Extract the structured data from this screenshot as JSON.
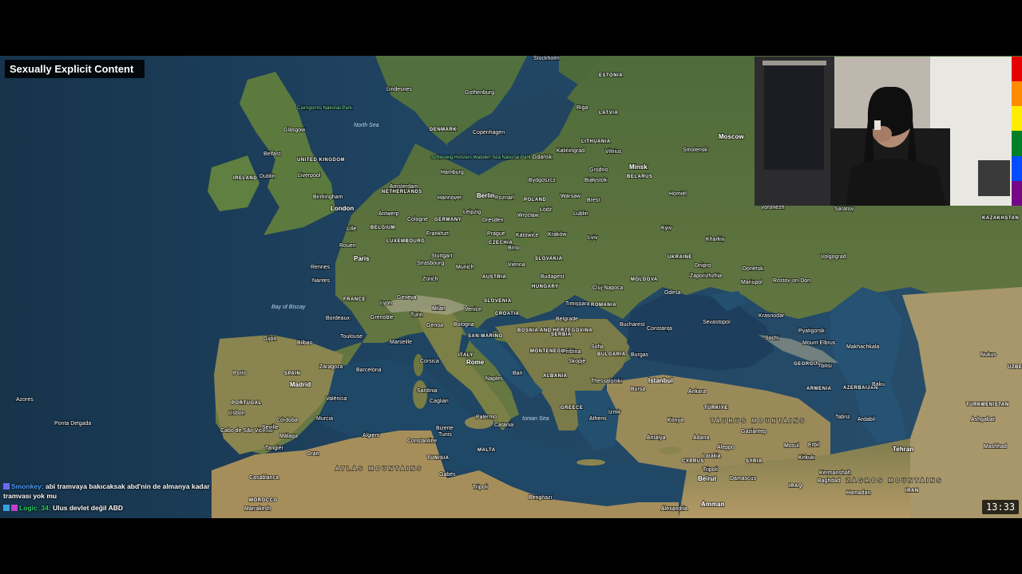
{
  "overlay": {
    "content_warning": "Sexually Explicit Content",
    "clock": "13:33",
    "rainbow_colors": [
      "#e40303",
      "#ff8c00",
      "#ffed00",
      "#008026",
      "#004dff",
      "#750787"
    ]
  },
  "chat": {
    "messages": [
      {
        "user": "Smonkey:",
        "user_color": "#4fa0ff",
        "text": "abi tramvaya bakıcaksak abd'nin de almanya kadar tramvası yok mu"
      },
      {
        "user": "Logic_34:",
        "user_color": "#2fd06a",
        "text": "Ulus devlet değil ABD"
      }
    ]
  },
  "map": {
    "labels": {
      "stockholm": "Stockholm",
      "estonia": "ESTONIA",
      "riga": "Riga",
      "latvia": "LATVIA",
      "lithuania": "LITHUANIA",
      "vilnius": "Vilnius",
      "minsk": "Minsk",
      "belarus": "BELARUS",
      "moscow": "Moscow",
      "smolensk": "Smolensk",
      "homiel": "Homiel",
      "brest": "Brest",
      "gothenburg": "Gothenburg",
      "denmark": "DENMARK",
      "copenhagen": "Copenhagen",
      "north_sea": "North Sea",
      "glasgow": "Glasgow",
      "cairngorms": "Cairngorms National Park",
      "belfast": "Belfast",
      "uk": "UNITED KINGDOM",
      "ireland": "IRELAND",
      "dublin": "Dublin",
      "liverpool": "Liverpool",
      "birmingham": "Birmingham",
      "london": "London",
      "wadden": "Schleswig-Holstein Wadden Sea National Park",
      "hamburg": "Hamburg",
      "gdansk": "Gdańsk",
      "kaliningrad": "Kaliningrad",
      "grodno": "Grodno",
      "bialystok": "Białystok",
      "bydgoszcz": "Bydgoszcz",
      "berlin": "Berlin",
      "poznan": "Poznań",
      "poland": "POLAND",
      "warsaw": "Warsaw",
      "lodz": "Łódź",
      "lublin": "Lublin",
      "wroclaw": "Wrocław",
      "netherlands": "NETHERLANDS",
      "amsterdam": "Amsterdam",
      "hanover": "Hannover",
      "antwerp": "Antwerp",
      "cologne": "Cologne",
      "germany": "GERMANY",
      "leipzig": "Leipzig",
      "dresden": "Dresden",
      "lille": "Lille",
      "belgium": "BELGIUM",
      "luxembourg": "LUXEMBOURG",
      "frankfurt": "Frankfurt",
      "prague": "Prague",
      "czechia": "CZECHIA",
      "katowice": "Katowice",
      "krakow": "Kraków",
      "lviv": "Lviv",
      "kyiv": "Kyiv",
      "kharkiv": "Kharkiv",
      "voronezh": "Voronezh",
      "saratov": "Saratov",
      "volgograd": "Volgograd",
      "rouen": "Rouen",
      "paris": "Paris",
      "stuttgart": "Stuttgart",
      "strasbourg": "Strasbourg",
      "munich": "Munich",
      "slovakia": "SLOVAKIA",
      "vienna": "Vienna",
      "brno": "Brno",
      "austria": "AUSTRIA",
      "budapest": "Budapest",
      "hungary": "HUNGARY",
      "ukraine": "UKRAINE",
      "dnipro": "Dnipro",
      "zaporizhzhia": "Zaporizhzhia",
      "donetsk": "Donetsk",
      "mariupol": "Mariupol",
      "rostov": "Rostov-on-Don",
      "moldova": "MOLDOVA",
      "cluj": "Cluj-Napoca",
      "romania": "ROMANIA",
      "timisoara": "Timișoara",
      "odesa": "Odesa",
      "rennes": "Rennes",
      "nantes": "Nantes",
      "france": "FRANCE",
      "zurich": "Zürich",
      "geneva": "Geneva",
      "lyon": "Lyon",
      "milan": "Milan",
      "venice": "Venice",
      "slovenia": "SLOVENIA",
      "croatia": "CROATIA",
      "belgrade": "Belgrade",
      "bucharest": "Bucharest",
      "constanta": "Constanța",
      "sevastopol": "Sevastopol",
      "krasnodar": "Krasnodar",
      "bay_of_biscay": "Bay of Biscay",
      "bordeaux": "Bordeaux",
      "grenoble": "Grenoble",
      "turin": "Turin",
      "genoa": "Genoa",
      "bologna": "Bologna",
      "bosnia": "BOSNIA AND HERZEGOVINA",
      "serbia": "SERBIA",
      "bulgaria": "BULGARIA",
      "sochi": "Sochi",
      "pyatigorsk": "Pyatigorsk",
      "makhachkala": "Makhachkala",
      "gijon": "Gijón",
      "bilbao": "Bilbao",
      "toulouse": "Toulouse",
      "marseille": "Marseille",
      "san_marino": "SAN MARINO",
      "montenegro": "MONTENEGRO",
      "pristina": "Priština",
      "sofia": "Sofia",
      "burgas": "Burgas",
      "georgia": "GEORGIA",
      "tbilisi": "Tbilisi",
      "porto": "Porto",
      "spain": "SPAIN",
      "zaragoza": "Zaragoza",
      "barcelona": "Barcelona",
      "rome": "Rome",
      "italy": "ITALY",
      "skopje": "Skopje",
      "albania": "ALBANIA",
      "thessaloniki": "Thessaloniki",
      "istanbul": "Istanbul",
      "madrid": "Madrid",
      "portugal": "PORTUGAL",
      "valencia": "València",
      "corsica": "Corsica",
      "sardinia": "Sardinia",
      "naples": "Naples",
      "bari": "Bari",
      "ankara": "Ankara",
      "armenia": "ARMENIA",
      "azerbaijan": "AZERBAIJAN",
      "baku": "Baku",
      "bursa": "Bursa",
      "azores": "Azores",
      "ponta_delgada": "Ponta Delgada",
      "lisbon": "Lisbon",
      "cordoba": "Córdoba",
      "murcia": "Murcia",
      "cagliari": "Cagliari",
      "ionian_sea": "Ionian Sea",
      "greece": "GREECE",
      "athens": "Athens",
      "izmir": "İzmir",
      "turkiye": "TÜRKİYE",
      "turkmenistan": "TURKMENISTAN",
      "ashgabat": "Ashgabat",
      "cabo": "Cabo de São Vicente",
      "seville": "Seville",
      "malaga": "Málaga",
      "algiers": "Algiers",
      "constantine": "Constantine",
      "bizerte": "Bizerte",
      "tunis": "Tunis",
      "palermo": "Palermo",
      "catania": "Catania",
      "konya": "Konya",
      "taurus": "TAURUS MOUNTAINS",
      "gaziantep": "Gaziantep",
      "tabriz": "Tabriz",
      "ardabil": "Ardabil",
      "tangier": "Tangier",
      "oran": "Oran",
      "atlas": "ATLAS MOUNTAINS",
      "tunisia": "TUNISIA",
      "malta": "MALTA",
      "antalya": "Antalya",
      "adana": "Adana",
      "aleppo": "Aleppo",
      "mosul": "Mosul",
      "erbil": "Erbil",
      "tehran": "Tehran",
      "mashhad": "Mashhad",
      "cyprus": "CYPRUS",
      "latakia": "Latakia",
      "syria": "SYRIA",
      "kirkuk": "Kirkuk",
      "zagros": "ZAGROS MOUNTAINS",
      "gabes": "Gabès",
      "beirut": "Beirut",
      "damascus": "Damascus",
      "casablanca": "Casablanca",
      "tripoli": "Tripoli",
      "tripoli_lb": "Tripoli",
      "morocco": "MOROCCO",
      "iraq": "IRAQ",
      "kermanshah": "Kermanshah",
      "baghdad": "Baghdad",
      "iran": "IRAN",
      "marrakesh": "Marrakesh",
      "benghazi": "Benghazi",
      "alexandria": "Alexandria",
      "amman": "Amman",
      "nukus": "Nukus",
      "kazakhstan": "KAZAKHSTAN",
      "uzbekistan": "UZBEKISTAN",
      "hamadan": "Hamadan",
      "lindesnes": "Lindesnes",
      "elbrus": "Mount Elbrus"
    }
  }
}
